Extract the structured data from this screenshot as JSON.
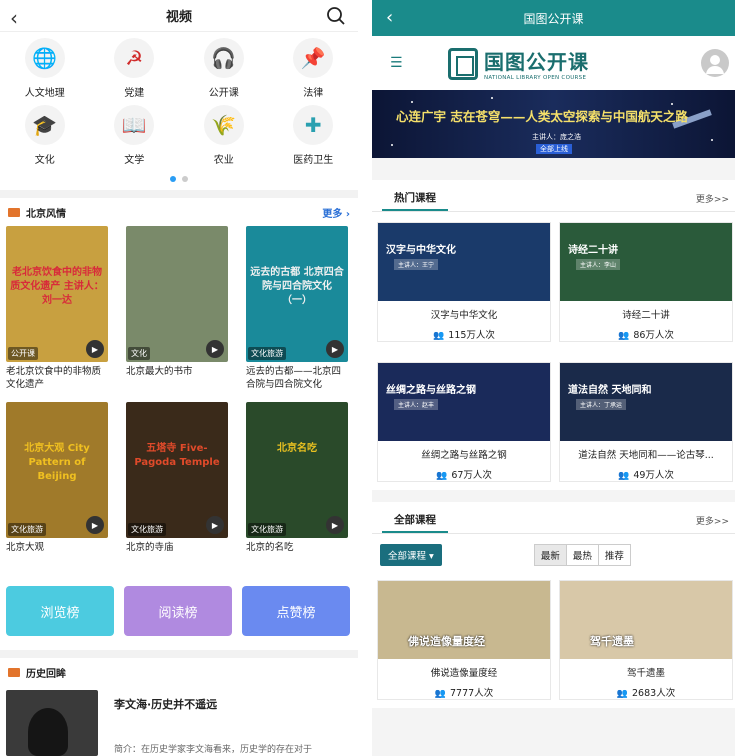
{
  "left": {
    "header": {
      "title": "视频",
      "back_icon": "chevron-left-icon",
      "search_icon": "search-icon"
    },
    "categories": [
      {
        "label": "人文地理",
        "icon": "globe-icon",
        "color": "#2e9e6a"
      },
      {
        "label": "党建",
        "icon": "party-emblem-icon",
        "color": "#d02a2a"
      },
      {
        "label": "公开课",
        "icon": "headset-person-icon",
        "color": "#2e9e6a"
      },
      {
        "label": "法律",
        "icon": "seal-stamp-icon",
        "color": "#d24a3a"
      },
      {
        "label": "文化",
        "icon": "graduation-cap-icon",
        "color": "#e0a02a"
      },
      {
        "label": "文学",
        "icon": "book-icon",
        "color": "#2a8aa0"
      },
      {
        "label": "农业",
        "icon": "wheat-icon",
        "color": "#e0b03a"
      },
      {
        "label": "医药卫生",
        "icon": "medical-cross-icon",
        "color": "#2aa0b0"
      }
    ],
    "section1": {
      "title": "北京风情",
      "more": "更多"
    },
    "videos": [
      {
        "title": "老北京饮食中的非物质文化遗产",
        "tag": "公开课",
        "caption": "老北京饮食中的非物质文化遗产 主讲人：刘一达",
        "bg": "#c8a040",
        "cap_color": "#d82a3a"
      },
      {
        "title": "北京最大的书市",
        "tag": "文化",
        "caption": "",
        "bg": "#7a8a6a",
        "cap_color": "#fff"
      },
      {
        "title": "远去的古都——北京四合院与四合院文化",
        "tag": "文化旅游",
        "caption": "远去的古都 北京四合院与四合院文化 （一）",
        "bg": "#1a8a9a",
        "cap_color": "#f0f0f0"
      },
      {
        "title": "北京大观",
        "tag": "文化旅游",
        "caption": "北京大观 City Pattern of Beijing",
        "bg": "#a07a2a",
        "cap_color": "#f0c020"
      },
      {
        "title": "北京的寺庙",
        "tag": "文化旅游",
        "caption": "五塔寺 Five-Pagoda Temple",
        "bg": "#3a2a1a",
        "cap_color": "#e04a2a"
      },
      {
        "title": "北京的名吃",
        "tag": "文化旅游",
        "caption": "北京名吃",
        "bg": "#2a4a2a",
        "cap_color": "#e8c020"
      }
    ],
    "ranks": [
      {
        "label": "浏览榜",
        "color": "#4ccbe0"
      },
      {
        "label": "阅读榜",
        "color": "#b08ae0"
      },
      {
        "label": "点赞榜",
        "color": "#6a8af0"
      }
    ],
    "section2": {
      "title": "历史回眸"
    },
    "history": {
      "title": "李文海·历史并不遥远",
      "desc": "简介：在历史学家李文海看来，历史学的存在对于"
    }
  },
  "right": {
    "header": {
      "title": "国图公开课",
      "back_icon": "chevron-left-icon"
    },
    "topbar": {
      "menu_icon": "hamburger-menu-icon",
      "logo_cn": "国图公开课",
      "logo_en": "NATIONAL LIBRARY OPEN COURSE",
      "avatar_icon": "user-avatar-icon"
    },
    "banner": {
      "title": "心连广宇 志在苍穹——人类太空探索与中国航天之路",
      "speaker": "主讲人：庞之浩",
      "badge": "全部上线"
    },
    "hot": {
      "title": "热门课程",
      "more": "更多>>"
    },
    "hot_courses": [
      {
        "title": "汉字与中华文化",
        "views": "115万人次",
        "img_title": "汉字与中华文化",
        "img_sub": "主讲人：王宁",
        "bg": "#1a3a6a"
      },
      {
        "title": "诗经二十讲",
        "views": "86万人次",
        "img_title": "诗经二十讲",
        "img_sub": "主讲人：李山",
        "bg": "#2a5a3a"
      },
      {
        "title": "丝绸之路与丝路之钢",
        "views": "67万人次",
        "img_title": "丝绸之路与丝路之钢",
        "img_sub": "主讲人：赵丰",
        "bg": "#1a2a5a"
      },
      {
        "title": "道法自然 天地同和——论古琴...",
        "views": "49万人次",
        "img_title": "道法自然 天地同和",
        "img_sub": "主讲人：丁承运",
        "bg": "#1a2a4a"
      }
    ],
    "all": {
      "title": "全部课程",
      "more": "更多>>"
    },
    "filter": {
      "dropdown": "全部课程",
      "tabs": [
        "最新",
        "最热",
        "推荐"
      ],
      "active": "最新"
    },
    "all_courses": [
      {
        "title": "佛说造像量度经",
        "views": "7777人次",
        "img_title": "佛说造像量度经",
        "bg": "#c8b890"
      },
      {
        "title": "驾千遗墨",
        "views": "2683人次",
        "img_title": "驾千遗墨",
        "bg": "#d8c8a8"
      }
    ],
    "people_icon": "people-icon"
  }
}
